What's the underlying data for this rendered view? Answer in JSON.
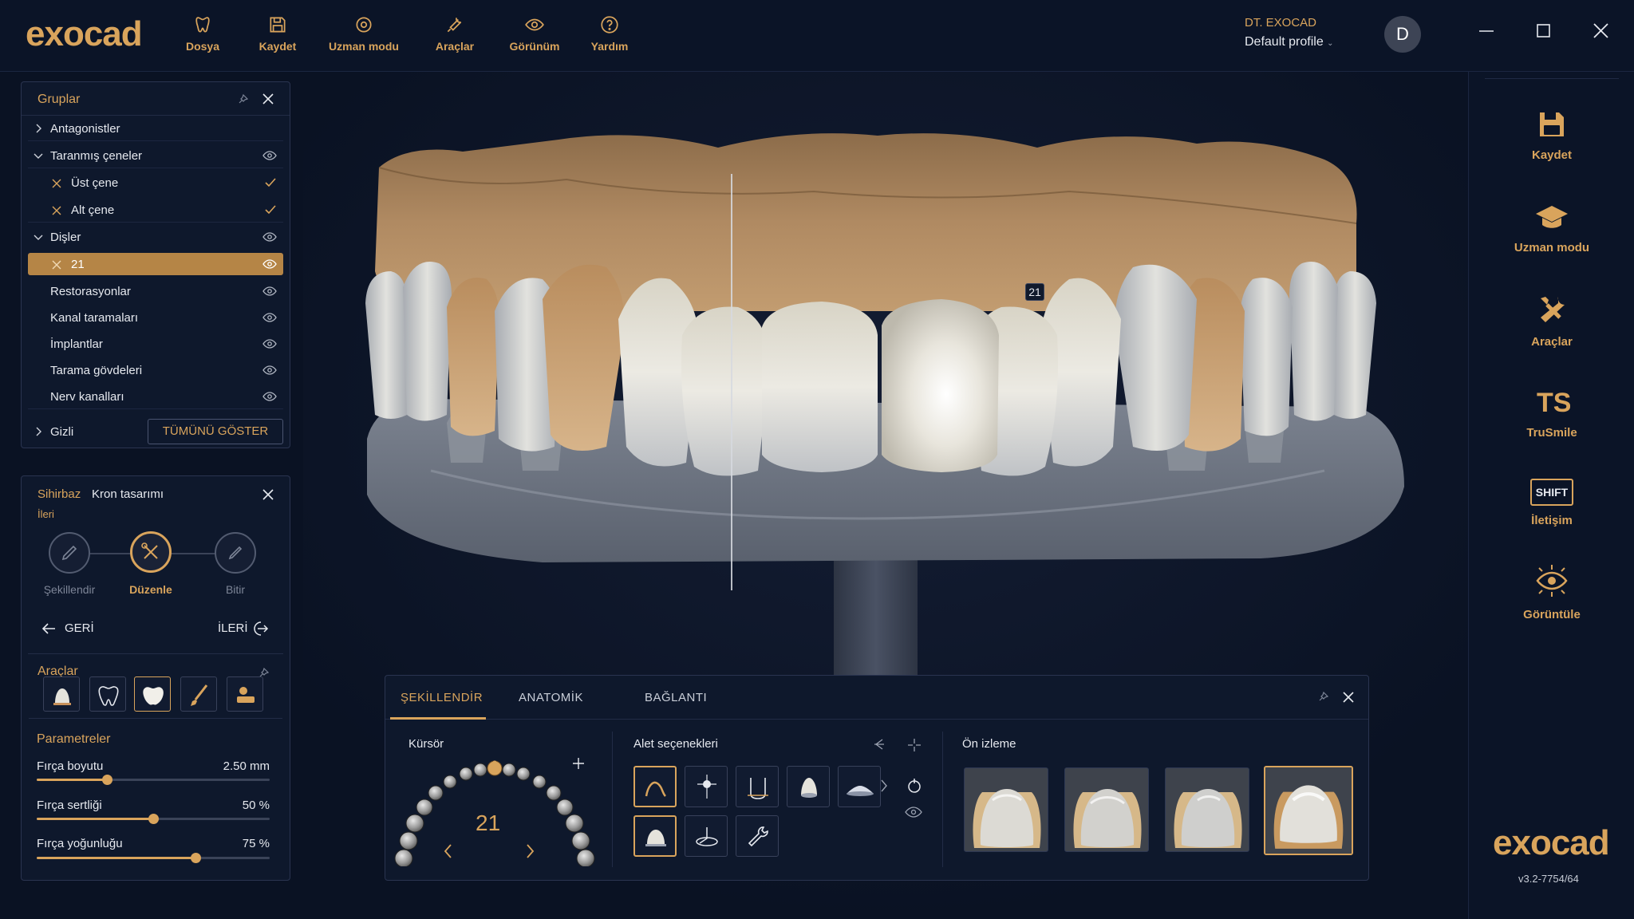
{
  "app": {
    "logo": "exocad",
    "version": "v3.2-7754/64"
  },
  "topbar": {
    "menu": [
      {
        "label": "Dosya",
        "icon": "file-icon"
      },
      {
        "label": "Kaydet",
        "icon": "save-icon"
      },
      {
        "label": "Uzman modu",
        "icon": "expert-mode-icon"
      },
      {
        "label": "Araçlar",
        "icon": "tools-icon"
      },
      {
        "label": "Görünüm",
        "icon": "eye-icon"
      },
      {
        "label": "Yardım",
        "icon": "help-icon"
      }
    ],
    "user_role": "DT. EXOCAD",
    "user_profile": "Default profile",
    "avatar_letter": "D"
  },
  "sidebar_right": {
    "items": [
      {
        "label": "Kaydet",
        "icon": "save-icon"
      },
      {
        "label": "Uzman modu",
        "icon": "graduation-cap-icon"
      },
      {
        "label": "Araçlar",
        "icon": "tools-icon"
      },
      {
        "label": "TruSmile",
        "icon": "trusmile-icon"
      },
      {
        "label": "İletişim",
        "icon": "shift-icon",
        "badge": "SHIFT"
      },
      {
        "label": "Görüntüle",
        "icon": "view-icon"
      }
    ]
  },
  "groups_panel": {
    "title": "Gruplar",
    "rows": [
      {
        "label": "Antagonistler"
      },
      {
        "label": "Taranmış çeneler"
      },
      {
        "label": "Üst çene"
      },
      {
        "label": "Alt çene"
      },
      {
        "label": "Dişler"
      },
      {
        "label": "21"
      },
      {
        "label": "Restorasyonlar"
      },
      {
        "label": "Kanal taramaları"
      },
      {
        "label": "İmplantlar"
      },
      {
        "label": "Tarama gövdeleri"
      },
      {
        "label": "Nerv kanalları"
      },
      {
        "label": "Gizli"
      }
    ],
    "show_all_label": "TÜMÜNÜ GÖSTER"
  },
  "wizard_panel": {
    "title": "Sihirbaz",
    "subtitle": "Kron tasarımı",
    "next_hint": "İleri",
    "steps": [
      {
        "label": "Şekillendir",
        "active": false
      },
      {
        "label": "Düzenle",
        "active": true
      },
      {
        "label": "Bitir",
        "active": false
      }
    ],
    "back_label": "GERİ",
    "forward_label": "İLERİ",
    "tools_title": "Araçlar",
    "params_title": "Parametreler",
    "params": [
      {
        "label": "Fırça boyutu",
        "value": "2.50 mm",
        "fraction": 0.3
      },
      {
        "label": "Fırça sertliği",
        "value": "50 %",
        "fraction": 0.5
      },
      {
        "label": "Fırça yoğunluğu",
        "value": "75 %",
        "fraction": 0.68
      }
    ]
  },
  "viewport": {
    "tooth_label": "21"
  },
  "bottom_panel": {
    "tabs": [
      {
        "label": "ŞEKİLLENDİR",
        "active": true
      },
      {
        "label": "ANATOMİK",
        "active": false
      },
      {
        "label": "BAĞLANTI",
        "active": false
      }
    ],
    "cursor_title": "Kürsör",
    "cursor_tooth": "21",
    "tool_options_title": "Alet seçenekleri",
    "preview_title": "Ön izleme"
  },
  "colors": {
    "accent": "#d9a45c",
    "background": "#0a1223",
    "panel": "#0e182c",
    "selected_row": "#b58546"
  }
}
